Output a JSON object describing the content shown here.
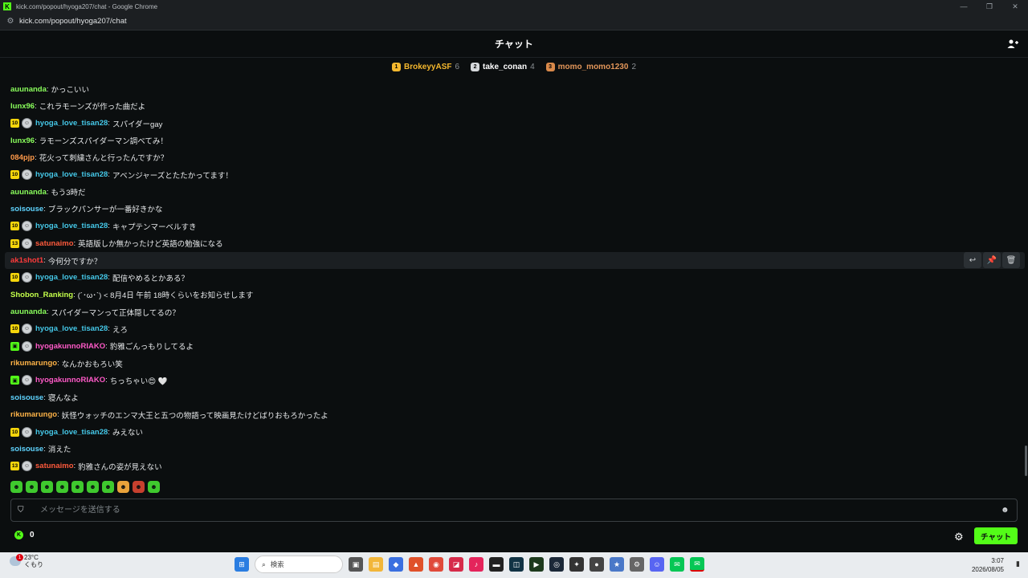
{
  "browser": {
    "window_title": "kick.com/popout/hyoga207/chat - Google Chrome",
    "url": "kick.com/popout/hyoga207/chat"
  },
  "header": {
    "title": "チャット"
  },
  "leaderboard": [
    {
      "rank": "1",
      "name": "BrokeyyASF",
      "count": "6",
      "color": "#f5b82e",
      "rank_bg": "#f5b82e"
    },
    {
      "rank": "2",
      "name": "take_conan",
      "count": "4",
      "color": "#ffffff",
      "rank_bg": "#d6d9dc"
    },
    {
      "rank": "3",
      "name": "momo_momo1230",
      "count": "2",
      "color": "#e2965a",
      "rank_bg": "#d9894a"
    }
  ],
  "messages": [
    {
      "badges": [],
      "user": "auunanda",
      "color": "#8aff5c",
      "text": "かっこいい"
    },
    {
      "badges": [],
      "user": "lunx96",
      "color": "#8aff5c",
      "text": "これラモーンズが作った曲だよ"
    },
    {
      "badges": [
        "10",
        "avatar"
      ],
      "user": "hyoga_love_tisan28",
      "color": "#45c8e8",
      "text": "スパイダーgay"
    },
    {
      "badges": [],
      "user": "lunx96",
      "color": "#8aff5c",
      "text": "ラモーンズスパイダーマン調べてみ！"
    },
    {
      "badges": [],
      "user": "084pjp",
      "color": "#ff9a4a",
      "text": "花火って刺繍さんと行ったんですか？"
    },
    {
      "badges": [
        "10",
        "avatar"
      ],
      "user": "hyoga_love_tisan28",
      "color": "#45c8e8",
      "text": "アベンジャーズとたたかってます！"
    },
    {
      "badges": [],
      "user": "auunanda",
      "color": "#8aff5c",
      "text": "もう3時だ"
    },
    {
      "badges": [],
      "user": "soisouse",
      "color": "#5fd4ff",
      "text": "ブラックパンサーが一番好きかな"
    },
    {
      "badges": [
        "10",
        "avatar"
      ],
      "user": "hyoga_love_tisan28",
      "color": "#45c8e8",
      "text": "キャプテンマーベルすき"
    },
    {
      "badges": [
        "13",
        "avatar"
      ],
      "user": "satunaimo",
      "color": "#ff5a3c",
      "text": "英語版しか無かったけど英語の勉強になる"
    },
    {
      "badges": [],
      "user": "ak1shot1",
      "color": "#ff3b3b",
      "text": "今何分ですか？"
    },
    {
      "badges": [
        "10",
        "avatar"
      ],
      "user": "hyoga_love_tisan28",
      "color": "#45c8e8",
      "text": "配信やめるとかある？"
    },
    {
      "badges": [],
      "user": "Shobon_Ranking",
      "color": "#c4ff4a",
      "text": "(´･ω･`) < 8月4日 午前 18時くらいをお知らせします"
    },
    {
      "badges": [],
      "user": "auunanda",
      "color": "#8aff5c",
      "text": "スパイダーマンって正体隠してるの？"
    },
    {
      "badges": [
        "10",
        "avatar"
      ],
      "user": "hyoga_love_tisan28",
      "color": "#45c8e8",
      "text": "えろ"
    },
    {
      "badges": [
        "gift",
        "avatar"
      ],
      "user": "hyogakunnoRIAKO",
      "color": "#ff5ac8",
      "text": "豹雅ごんっもりしてるよ"
    },
    {
      "badges": [],
      "user": "rikumarungo",
      "color": "#ffb347",
      "text": "なんかおもろい笑"
    },
    {
      "badges": [
        "gift",
        "avatar"
      ],
      "user": "hyogakunnoRIAKO",
      "color": "#ff5ac8",
      "text": "ちっちゃい😍 🤍"
    },
    {
      "badges": [],
      "user": "soisouse",
      "color": "#5fd4ff",
      "text": "寝んなよ"
    },
    {
      "badges": [],
      "user": "rikumarungo",
      "color": "#ffb347",
      "text": "妖怪ウォッチのエンマ大王と五つの物語って映画見たけどばりおもろかったよ"
    },
    {
      "badges": [
        "10",
        "avatar"
      ],
      "user": "hyoga_love_tisan28",
      "color": "#45c8e8",
      "text": "みえない"
    },
    {
      "badges": [],
      "user": "soisouse",
      "color": "#5fd4ff",
      "text": "消えた"
    },
    {
      "badges": [
        "13",
        "avatar"
      ],
      "user": "satunaimo",
      "color": "#ff5a3c",
      "text": "豹雅さんの姿が見えない"
    }
  ],
  "input": {
    "placeholder": "メッセージを送信する"
  },
  "footer": {
    "kick_coins": "0",
    "send_label": "チャット"
  },
  "taskbar": {
    "temperature": "23°C",
    "weather": "くもり",
    "weather_notifications": "1",
    "search_placeholder": "検索",
    "time": "3:07",
    "date": "2026/08/05"
  }
}
